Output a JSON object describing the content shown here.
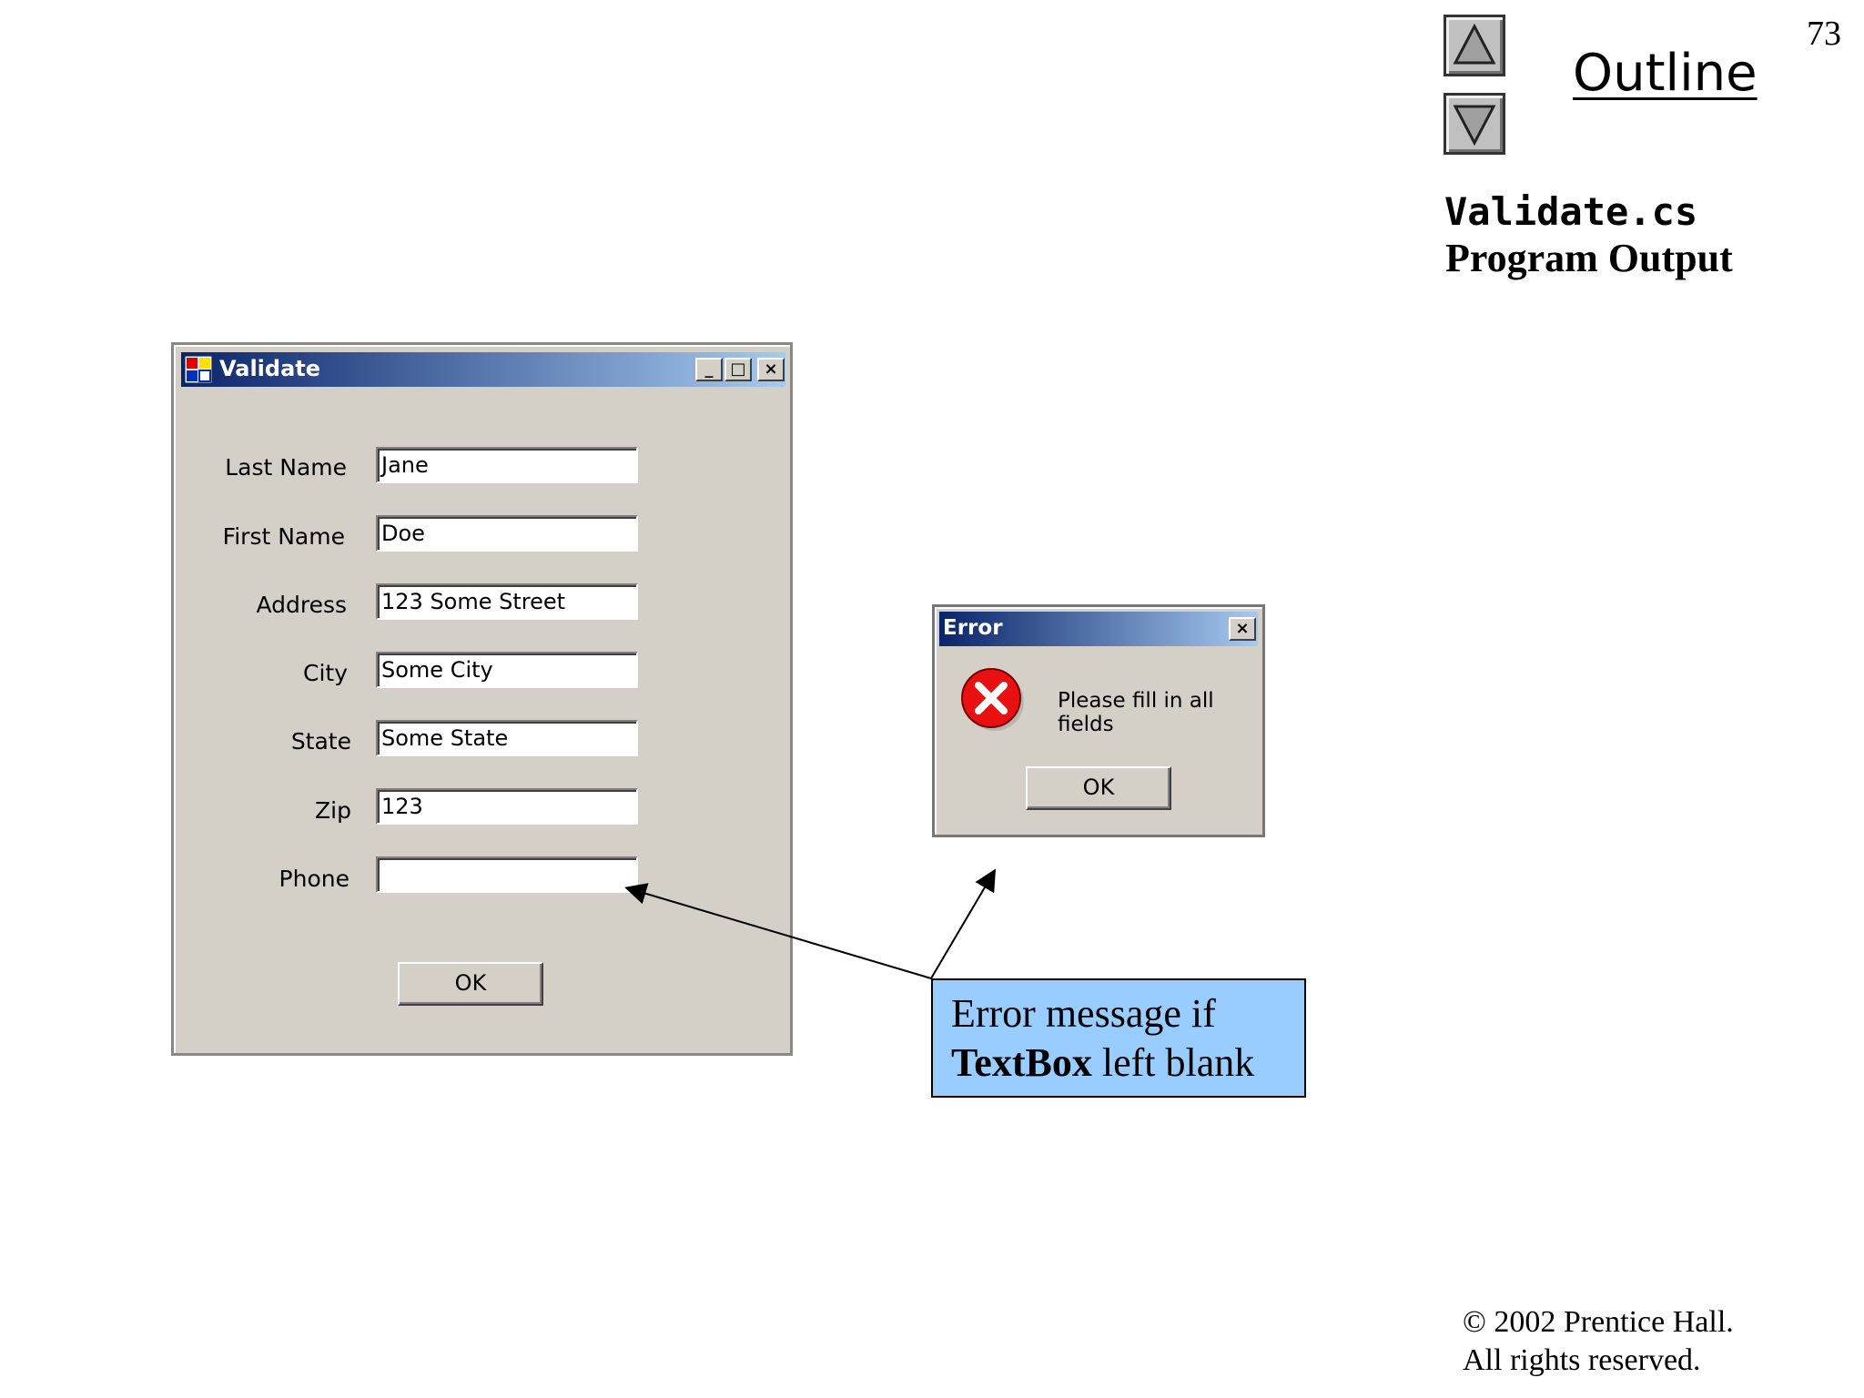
{
  "slide": {
    "page_number": "73",
    "outline_label": "Outline",
    "file_name": "Validate.cs",
    "subtitle": "Program Output",
    "copyright_line1": "© 2002 Prentice Hall.",
    "copyright_line2": "All rights reserved."
  },
  "validate_window": {
    "title": "Validate",
    "minimize_glyph": "_",
    "maximize_glyph": "□",
    "close_glyph": "×",
    "fields": [
      {
        "label": "Last Name",
        "value": "Jane"
      },
      {
        "label": "First Name",
        "value": "Doe"
      },
      {
        "label": "Address",
        "value": "123 Some Street"
      },
      {
        "label": "City",
        "value": "Some City"
      },
      {
        "label": "State",
        "value": "Some State"
      },
      {
        "label": "Zip",
        "value": "123"
      },
      {
        "label": "Phone",
        "value": ""
      }
    ],
    "ok_label": "OK"
  },
  "error_dialog": {
    "title": "Error",
    "close_glyph": "×",
    "message": "Please fill in all fields",
    "ok_label": "OK",
    "icon": "error-icon"
  },
  "callout": {
    "line1": "Error message if",
    "bold_word": "TextBox",
    "line2_rest": " left blank"
  },
  "colors": {
    "title_bar_start": "#0a246a",
    "title_bar_end": "#a6caf0",
    "window_face": "#d4d0c8",
    "callout_fill": "#99ccff",
    "error_red": "#e81010"
  }
}
